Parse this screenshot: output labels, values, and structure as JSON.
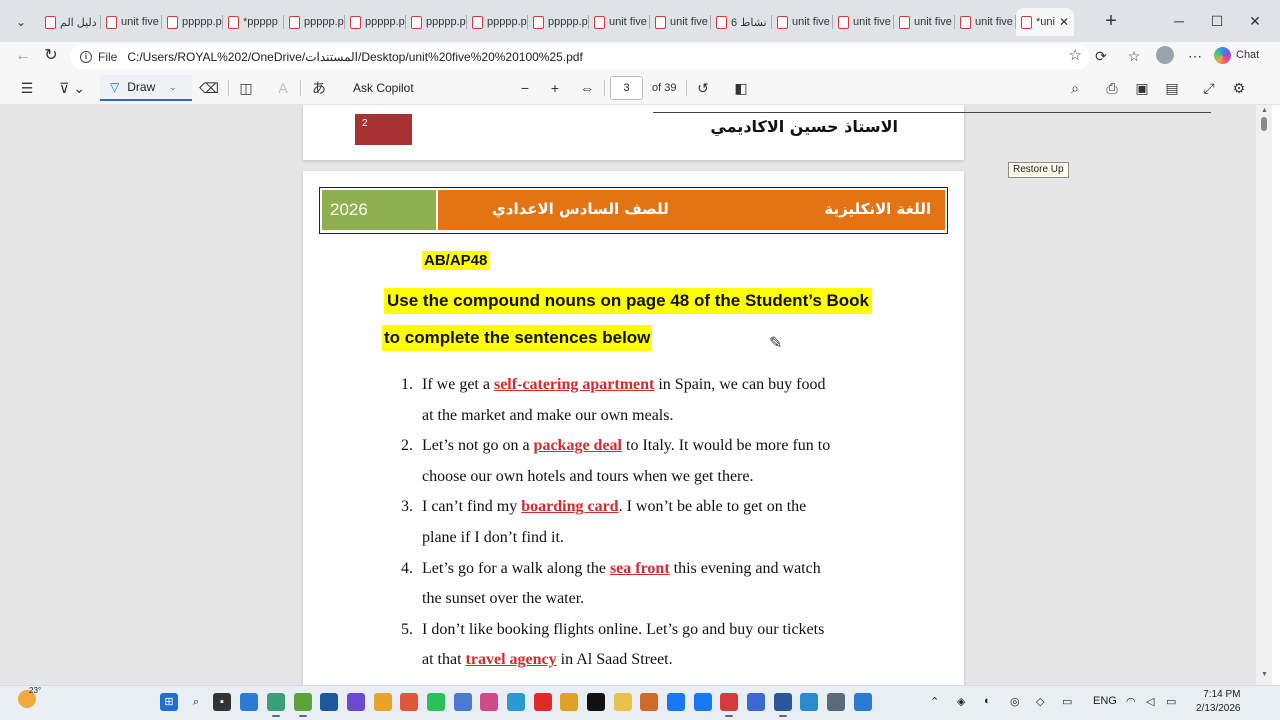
{
  "tabs": [
    {
      "label": "دليل الم"
    },
    {
      "label": "unit five"
    },
    {
      "label": "ppppp.p"
    },
    {
      "label": "*ppppp"
    },
    {
      "label": "ppppp.p"
    },
    {
      "label": "ppppp.p"
    },
    {
      "label": "ppppp.p"
    },
    {
      "label": "ppppp.p"
    },
    {
      "label": "ppppp.p"
    },
    {
      "label": "unit five"
    },
    {
      "label": "unit five"
    },
    {
      "label": "6 نشاط"
    },
    {
      "label": "unit five"
    },
    {
      "label": "unit five"
    },
    {
      "label": "unit five"
    },
    {
      "label": "unit five"
    }
  ],
  "active_tab": {
    "label": "*uni",
    "close": "✕"
  },
  "new_tab": "+",
  "address": {
    "scheme": "File",
    "url": "C:/Users/ROYAL%202/OneDrive/المستندات/Desktop/unit%20five%20%20100%25.pdf"
  },
  "chat_label": "Chat",
  "pdf_toolbar": {
    "draw_label": "Draw",
    "ask_copilot": "Ask Copilot",
    "page_value": "3",
    "page_total": "of 39"
  },
  "tooltip": "Restore Up",
  "prev_page": {
    "page_number": "2",
    "author": "الاستاذ حسين الاكاديمي"
  },
  "banner": {
    "year": "2026",
    "grade": "للصف السادس الاعدادي",
    "subject": "اللغة الانكليزية"
  },
  "exercise": {
    "code": "AB/AP48",
    "instruction_line1": "Use the compound nouns on page 48 of the Student’s Book",
    "instruction_line2": "to complete the sentences below"
  },
  "items": [
    {
      "n": "1.",
      "pre": "If we get a ",
      "answer": "self-catering apartment",
      "post": " in Spain, we can buy food",
      "line2": "at the market and make our own meals."
    },
    {
      "n": "2.",
      "pre": "Let’s not go on a ",
      "answer": "package deal",
      "post": " to Italy. It would be more fun to",
      "line2": "choose our own hotels and tours when we get there."
    },
    {
      "n": "3.",
      "pre": "I can’t find my ",
      "answer": "boarding card",
      "post": ". I won’t be able to get on the",
      "line2": "plane if I don’t find it."
    },
    {
      "n": "4.",
      "pre": "Let’s go for a walk along the ",
      "answer": "sea front",
      "post": " this evening and watch",
      "line2": "the sunset over the water."
    },
    {
      "n": "5.",
      "pre": "I don’t like booking flights online. Let’s go and buy our tickets",
      "answer": "",
      "post": "",
      "line2_pre": "at that ",
      "line2_answer": "travel agency",
      "line2_post": " in Al Saad Street."
    }
  ],
  "taskbar": {
    "temperature": "23°",
    "language": "ENG",
    "time": "7:14 PM",
    "date": "2/13/2026"
  },
  "colors": {
    "banner_green": "#8fb04e",
    "banner_orange": "#e47413",
    "answer_red": "#d42a2a",
    "highlight": "#ffff00"
  }
}
